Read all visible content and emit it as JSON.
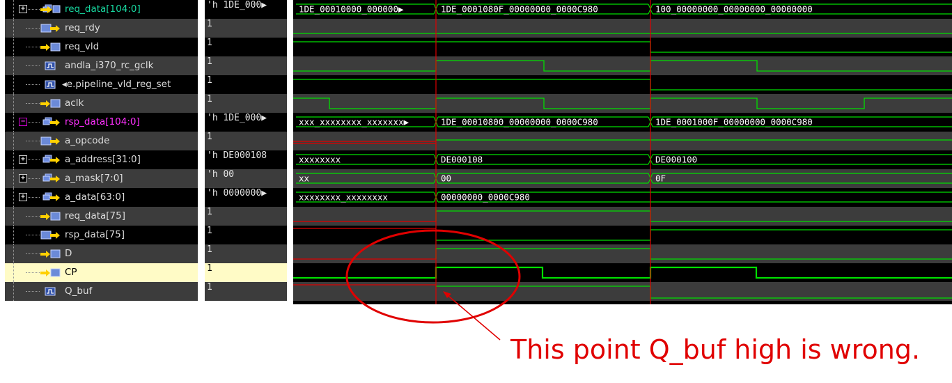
{
  "signals": [
    {
      "name": "req_data[104:0]",
      "value": "'h 1DE_000▶",
      "kind": "bus",
      "color": "cyan",
      "expand": "+",
      "bus": [
        "1DE_00010000_000000▶",
        "1DE_0001080F_00000000_0000C980",
        "100_00000000_00000000_00000000"
      ]
    },
    {
      "name": "req_rdy",
      "value": "1",
      "kind": "in"
    },
    {
      "name": "req_vld",
      "value": "1",
      "kind": "out"
    },
    {
      "name": "andla_i370_rc_gclk",
      "value": "1",
      "kind": "wire"
    },
    {
      "name": "◂e.pipeline_vld_reg_set",
      "value": "1",
      "kind": "wire"
    },
    {
      "name": "aclk",
      "value": "1",
      "kind": "out"
    },
    {
      "name": "rsp_data[104:0]",
      "value": "'h 1DE_000▶",
      "kind": "busin",
      "color": "magenta",
      "expand": "−",
      "bus": [
        "xxx_xxxxxxxx_xxxxxxx▶",
        "1DE_00010800_00000000_0000C980",
        "1DE_0001000F_00000000_0000C980"
      ]
    },
    {
      "name": "a_opcode",
      "value": "1",
      "kind": "in"
    },
    {
      "name": "a_address[31:0]",
      "value": "'h DE000108",
      "kind": "busin",
      "expand": "+",
      "bus": [
        "xxxxxxxx",
        "DE000108",
        "DE000100"
      ]
    },
    {
      "name": "a_mask[7:0]",
      "value": "'h 00",
      "kind": "busin",
      "expand": "+",
      "bus": [
        "xx",
        "00",
        "0F"
      ]
    },
    {
      "name": "a_data[63:0]",
      "value": "'h 0000000▶",
      "kind": "busin",
      "expand": "+",
      "bus": [
        "xxxxxxxx_xxxxxxxx",
        "00000000_0000C980"
      ]
    },
    {
      "name": "req_data[75]",
      "value": "1",
      "kind": "out"
    },
    {
      "name": "rsp_data[75]",
      "value": "1",
      "kind": "in"
    },
    {
      "name": "D",
      "value": "1",
      "kind": "out"
    },
    {
      "name": "CP",
      "value": "1",
      "kind": "out",
      "highlight": true
    },
    {
      "name": "Q_buf",
      "value": "1",
      "kind": "wire"
    }
  ],
  "annotation": "This point Q_buf high is wrong.",
  "colors": {
    "wave": "#00e000",
    "marker": "#e00000",
    "annotation": "#e00000",
    "bus_text": "#ffffff"
  }
}
